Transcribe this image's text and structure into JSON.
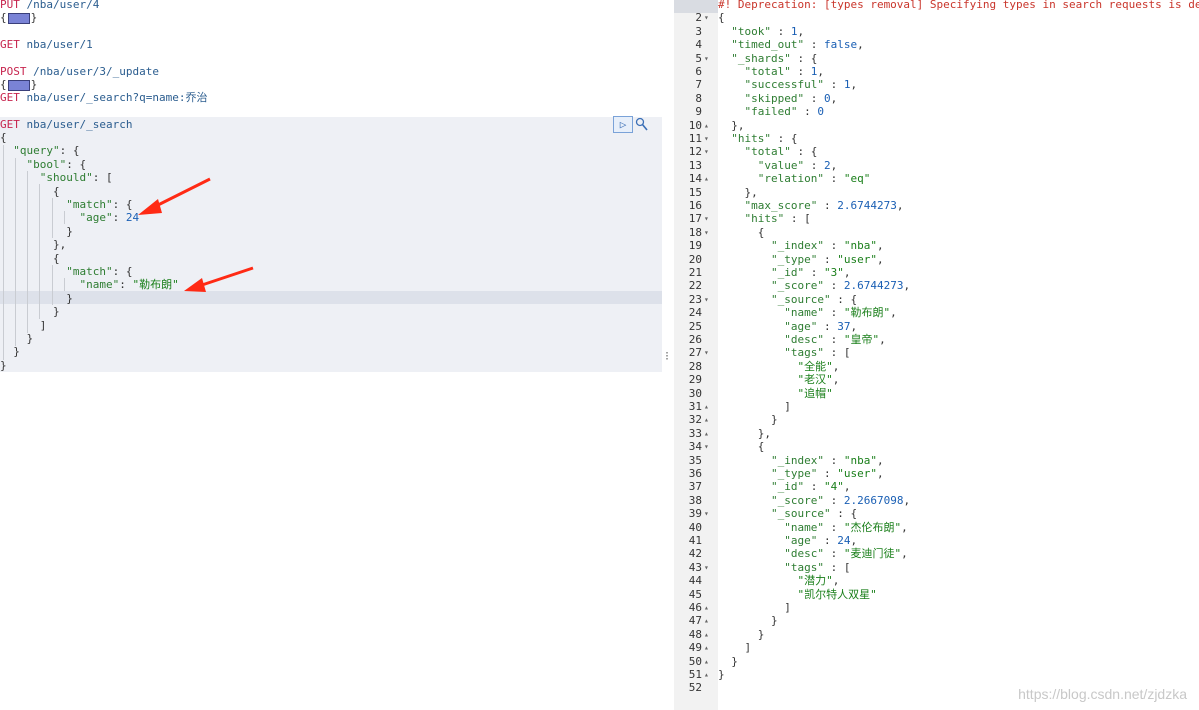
{
  "left": {
    "block1_method": "PUT",
    "block1_path": " /nba/user/4",
    "block1_brace": "{",
    "block1_close": "}",
    "block2_method": "GET",
    "block2_path": " nba/user/1",
    "block3_method": "POST",
    "block3_path": " /nba/user/3/_update",
    "block3_brace": "{",
    "block3_close": "}",
    "block4_method": "GET",
    "block4_path": " nba/user/_search?q=name:乔治",
    "block5_method": "GET",
    "block5_path": " nba/user/_search",
    "lines": [
      "{",
      "  \"query\": {",
      "    \"bool\": {",
      "      \"should\": [",
      "        {",
      "          \"match\": {",
      "            \"age\": 24",
      "          }",
      "        },",
      "        {",
      "          \"match\": {",
      "            \"name\": \"勒布朗\"",
      "          }",
      "        }",
      "      ]",
      "    }",
      "  }",
      "}"
    ],
    "run_icon": "play-icon",
    "settings_icon": "wrench-icon"
  },
  "right": {
    "lines": [
      "#! Deprecation: [types removal] Specifying types in search requests is deprecated.",
      "{",
      "  \"took\" : 1,",
      "  \"timed_out\" : false,",
      "  \"_shards\" : {",
      "    \"total\" : 1,",
      "    \"successful\" : 1,",
      "    \"skipped\" : 0,",
      "    \"failed\" : 0",
      "  },",
      "  \"hits\" : {",
      "    \"total\" : {",
      "      \"value\" : 2,",
      "      \"relation\" : \"eq\"",
      "    },",
      "    \"max_score\" : 2.6744273,",
      "    \"hits\" : [",
      "      {",
      "        \"_index\" : \"nba\",",
      "        \"_type\" : \"user\",",
      "        \"_id\" : \"3\",",
      "        \"_score\" : 2.6744273,",
      "        \"_source\" : {",
      "          \"name\" : \"勒布朗\",",
      "          \"age\" : 37,",
      "          \"desc\" : \"皇帝\",",
      "          \"tags\" : [",
      "            \"全能\",",
      "            \"老汉\",",
      "            \"追帽\"",
      "          ]",
      "        }",
      "      },",
      "      {",
      "        \"_index\" : \"nba\",",
      "        \"_type\" : \"user\",",
      "        \"_id\" : \"4\",",
      "        \"_score\" : 2.2667098,",
      "        \"_source\" : {",
      "          \"name\" : \"杰伦布朗\",",
      "          \"age\" : 24,",
      "          \"desc\" : \"麦迪门徒\",",
      "          \"tags\" : [",
      "            \"潜力\",",
      "            \"凯尔特人双星\"",
      "          ]",
      "        }",
      "      }",
      "    ]",
      "  }",
      "}",
      ""
    ],
    "fold_markers": {
      "2": "▾",
      "5": "▾",
      "10": "▴",
      "11": "▾",
      "12": "▾",
      "14": "▴",
      "17": "▾",
      "18": "▾",
      "23": "▾",
      "27": "▾",
      "31": "▴",
      "32": "▴",
      "33": "▴",
      "34": "▾",
      "39": "▾",
      "43": "▾",
      "46": "▴",
      "47": "▴",
      "48": "▴",
      "49": "▴",
      "50": "▴",
      "51": "▴"
    }
  },
  "watermark": "https://blog.csdn.net/zjdzka",
  "colors": {
    "keyword": "#c7254e",
    "string": "#1a7f1a",
    "number": "#1a5fb4",
    "comment": "#c9352b",
    "arrow": "#ff2a14"
  }
}
